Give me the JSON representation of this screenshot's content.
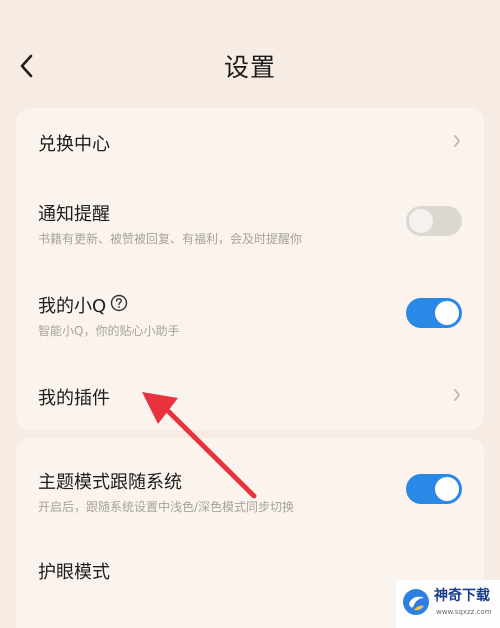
{
  "header": {
    "title": "设置"
  },
  "settings": {
    "redeem_center": {
      "label": "兑换中心"
    },
    "notifications": {
      "label": "通知提醒",
      "description": "书籍有更新、被赞被回复、有福利，会及时提醒你",
      "enabled": false
    },
    "my_xiaoq": {
      "label": "我的小Q",
      "description": "智能小Q，你的贴心小助手",
      "enabled": true
    },
    "my_plugins": {
      "label": "我的插件"
    },
    "theme_follow_system": {
      "label": "主题模式跟随系统",
      "description": "开启后，跟随系统设置中浅色/深色模式同步切换",
      "enabled": true
    },
    "eye_care_mode": {
      "label": "护眼模式"
    }
  },
  "watermark": {
    "title": "神奇下载",
    "url": "www.sqxzz.com"
  },
  "colors": {
    "background": "#f7ece4",
    "card": "#fbf4ee",
    "toggle_on": "#2a89e6",
    "toggle_off": "#ddd7d2",
    "annotation_arrow": "#e8333f"
  },
  "icons": {
    "back": "chevron-left-icon",
    "chevron": "chevron-right-icon",
    "help": "question-circle-icon"
  }
}
